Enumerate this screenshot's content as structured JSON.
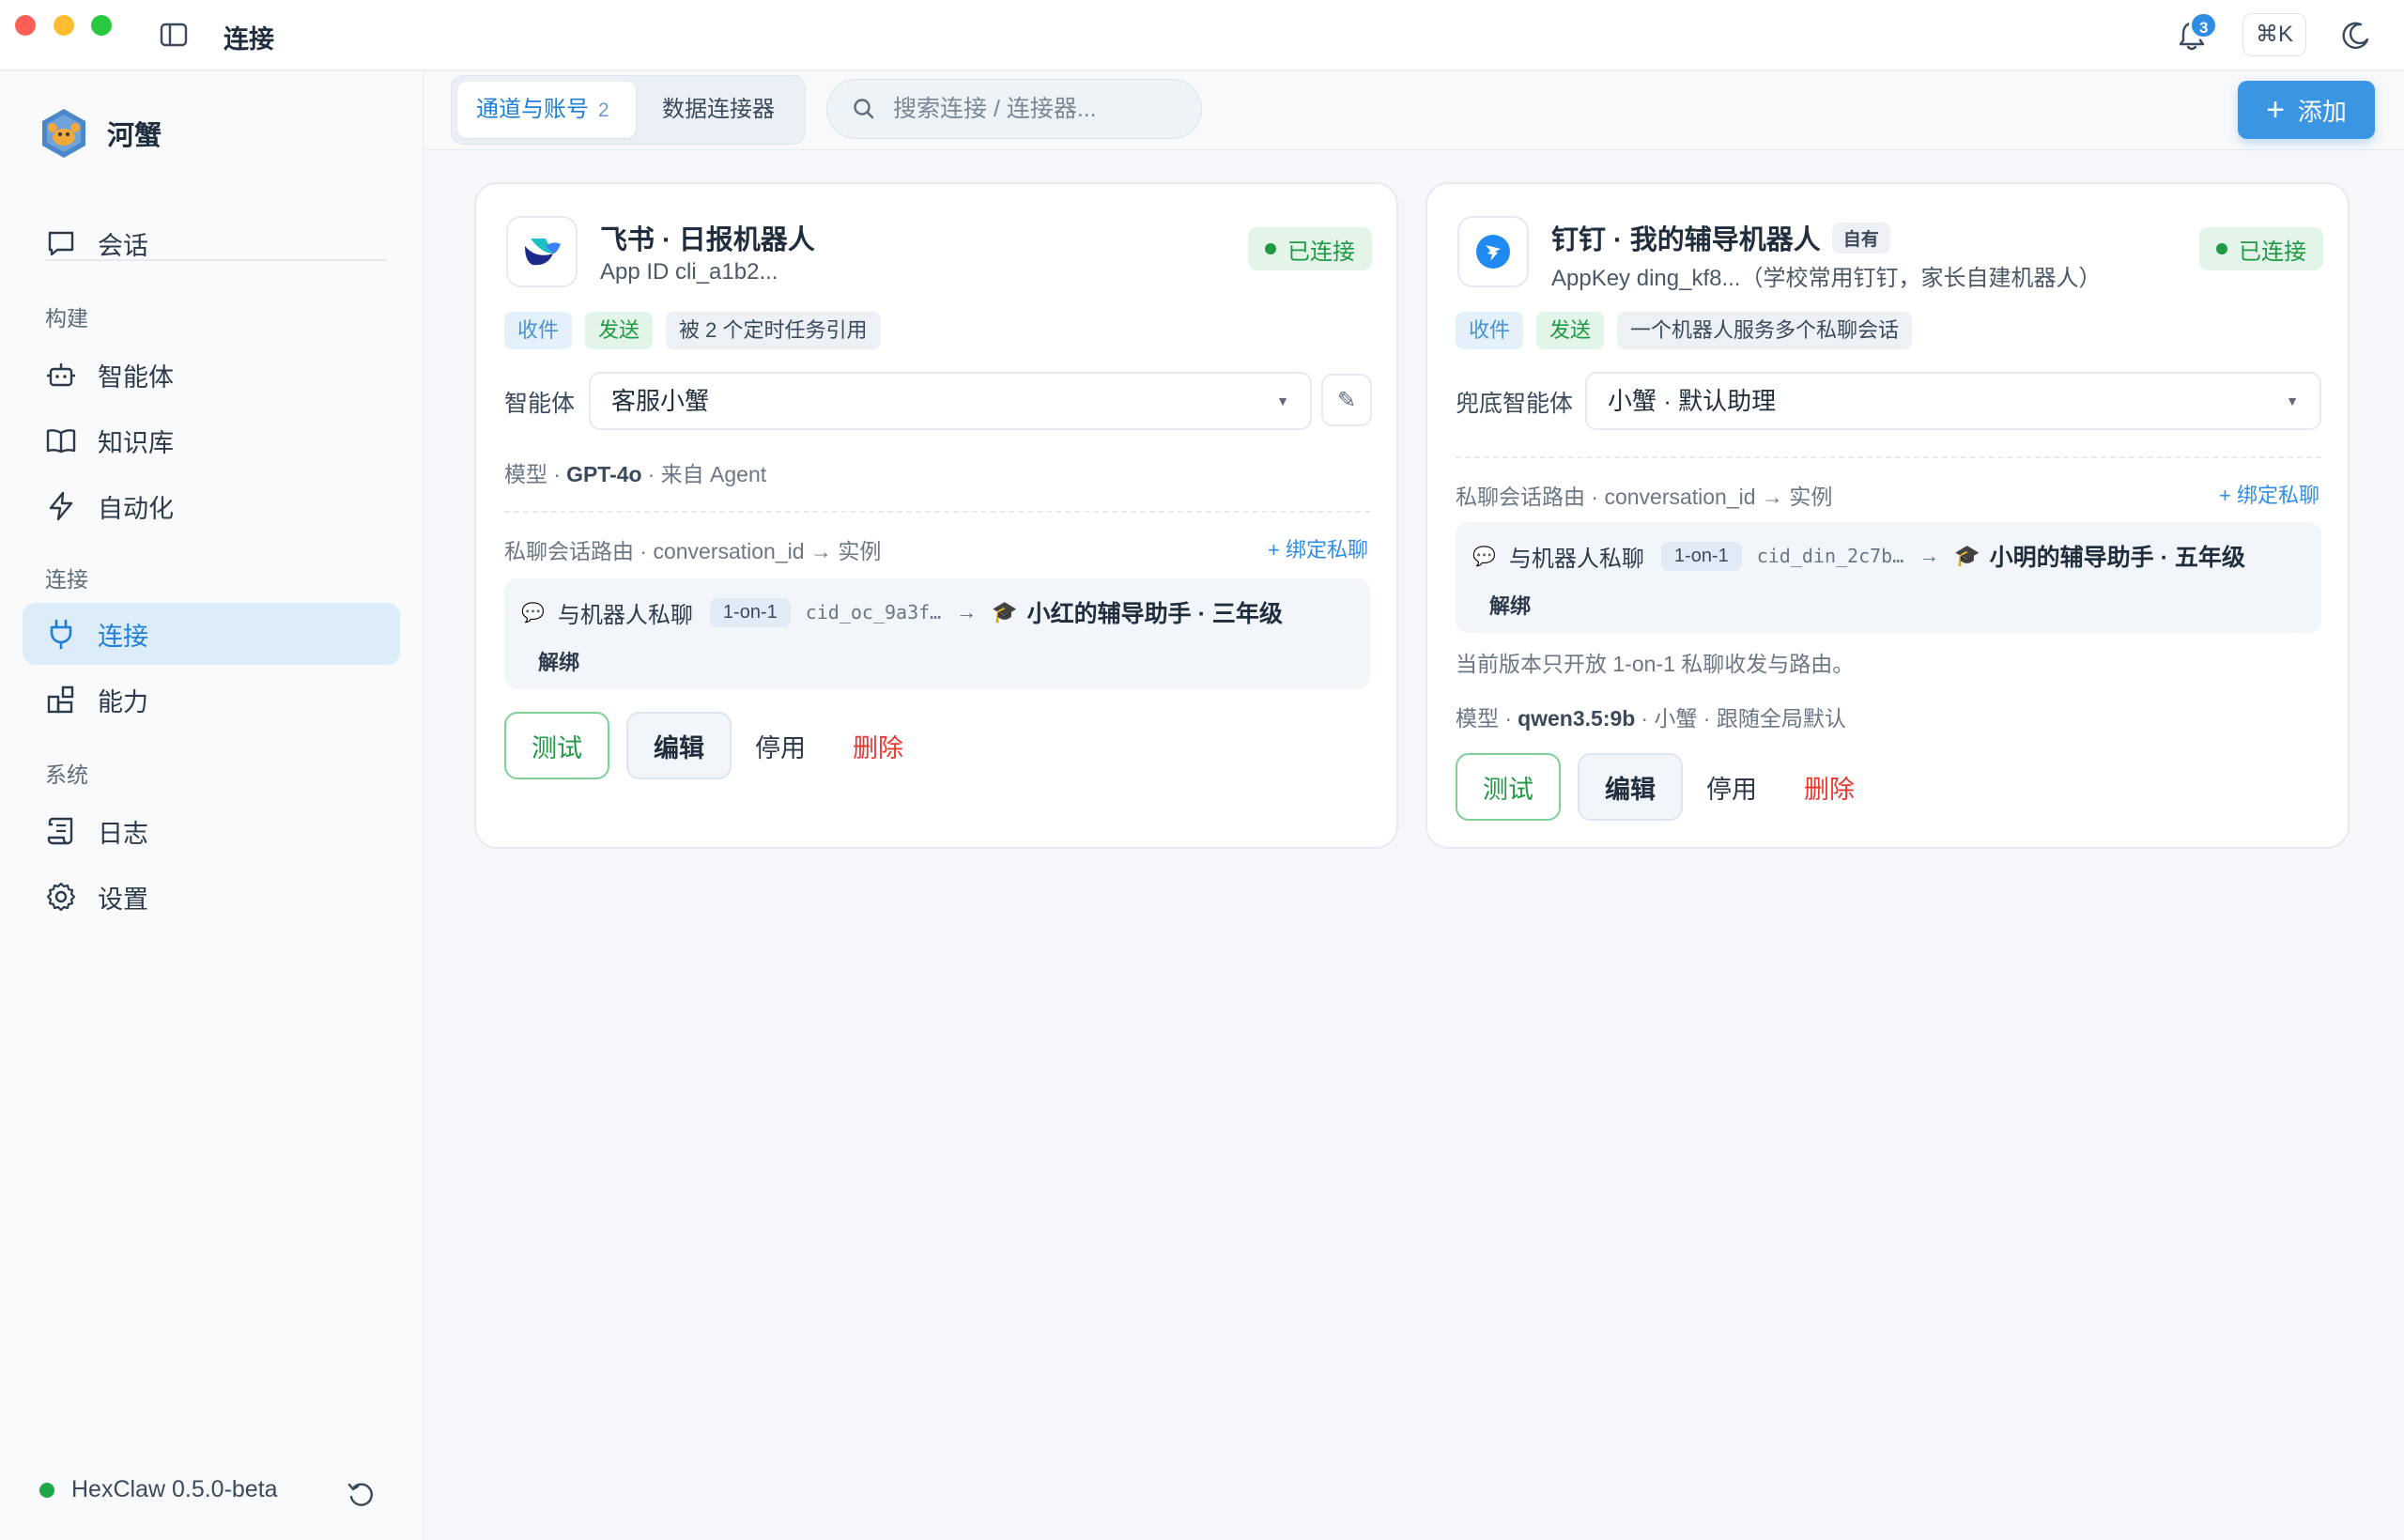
{
  "window": {
    "title": "连接"
  },
  "header": {
    "notification_count": "3",
    "shortcut": "⌘K"
  },
  "sidebar": {
    "brand": "河蟹",
    "top_items": [
      {
        "label": "会话",
        "icon": "chat-bubble-icon"
      }
    ],
    "sections": [
      {
        "title": "构建",
        "items": [
          {
            "label": "智能体",
            "icon": "robot-icon"
          },
          {
            "label": "知识库",
            "icon": "book-icon"
          },
          {
            "label": "自动化",
            "icon": "lightning-icon"
          }
        ]
      },
      {
        "title": "连接",
        "items": [
          {
            "label": "连接",
            "icon": "plug-icon",
            "active": true
          },
          {
            "label": "能力",
            "icon": "blocks-icon"
          }
        ]
      },
      {
        "title": "系统",
        "items": [
          {
            "label": "日志",
            "icon": "scroll-icon"
          },
          {
            "label": "设置",
            "icon": "gear-icon"
          }
        ]
      }
    ],
    "footer": {
      "version": "HexClaw 0.5.0-beta",
      "status_color": "#1fa64a"
    }
  },
  "toolbar": {
    "tabs": [
      {
        "label": "通道与账号",
        "count": "2",
        "active": true
      },
      {
        "label": "数据连接器",
        "active": false
      }
    ],
    "search_placeholder": "搜索连接 / 连接器...",
    "add_label": "添加"
  },
  "cards": [
    {
      "title": "飞书 · 日报机器人",
      "subtitle": "App ID cli_a1b2...",
      "status": "已连接",
      "tags": [
        "收件",
        "发送",
        "被 2 个定时任务引用"
      ],
      "agent_label": "智能体",
      "agent_value": "客服小蟹",
      "model_prefix": "模型 ·",
      "model_name": "GPT-4o",
      "model_suffix": "· 来自 Agent",
      "route_label": "私聊会话路由 · conversation_id → 实例",
      "bind_label": "+ 绑定私聊",
      "route": {
        "pair": "与机器人私聊",
        "mode": "1-on-1",
        "cid": "cid_oc_9a3f…",
        "instance": "小红的辅导助手 · 三年级",
        "unbind": "解绑"
      },
      "actions": {
        "test": "测试",
        "edit": "编辑",
        "disable": "停用",
        "delete": "删除"
      }
    },
    {
      "title": "钉钉 · 我的辅导机器人",
      "badge": "自有",
      "subtitle": "AppKey ding_kf8...（学校常用钉钉，家长自建机器人）",
      "status": "已连接",
      "tags": [
        "收件",
        "发送",
        "一个机器人服务多个私聊会话"
      ],
      "agent_label": "兜底智能体",
      "agent_value": "小蟹 · 默认助理",
      "route_label": "私聊会话路由 · conversation_id → 实例",
      "bind_label": "+ 绑定私聊",
      "route": {
        "pair": "与机器人私聊",
        "mode": "1-on-1",
        "cid": "cid_din_2c7b…",
        "instance": "小明的辅导助手 · 五年级",
        "unbind": "解绑"
      },
      "note": "当前版本只开放 1-on-1 私聊收发与路由。",
      "model_prefix": "模型 ·",
      "model_name": "qwen3.5:9b",
      "model_suffix": "· 小蟹 · 跟随全局默认",
      "actions": {
        "test": "测试",
        "edit": "编辑",
        "disable": "停用",
        "delete": "删除"
      }
    }
  ],
  "colors": {
    "accent": "#2f8de4",
    "success": "#1f9a44",
    "danger": "#e8372f"
  }
}
